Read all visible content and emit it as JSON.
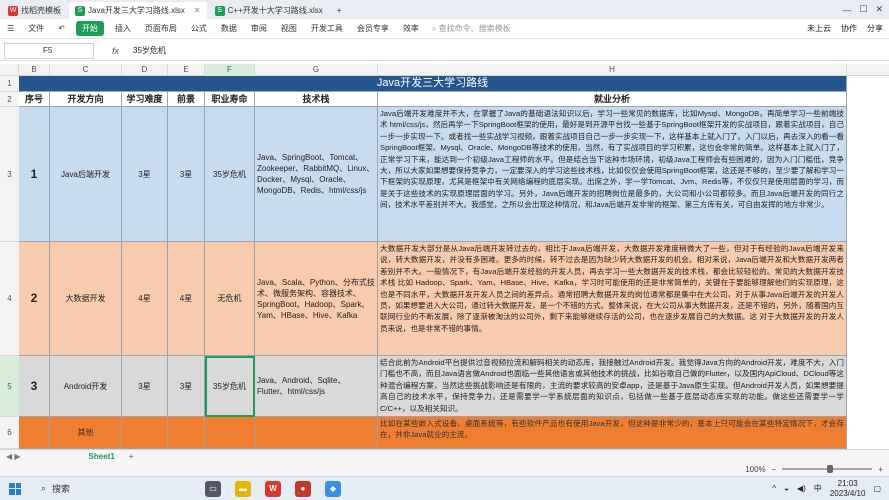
{
  "titlebar": {
    "tabs": [
      {
        "label": "找稻壳模板",
        "color": "#d9382b",
        "glyph": "W"
      },
      {
        "label": "Java开发三大学习路线.xlsx",
        "color": "#1f9c58",
        "glyph": "S",
        "active": true
      },
      {
        "label": "C++开发十大学习路线.xlsx",
        "color": "#1f9c58",
        "glyph": "S"
      }
    ],
    "add_tab": "+",
    "window_controls": [
      "—",
      "☐",
      "✕"
    ]
  },
  "ribbon": {
    "file": "文件",
    "menu_items": [
      "开始",
      "插入",
      "页面布局",
      "公式",
      "数据",
      "审阅",
      "视图",
      "开发工具",
      "会员专享",
      "效率"
    ],
    "search_placeholder": "查找命令、搜索模板",
    "right_items": [
      "未上云",
      "协作",
      "分享"
    ]
  },
  "formula_bar": {
    "cell_ref": "F5",
    "fx": "fx",
    "content": "35岁危机"
  },
  "columns": [
    "B",
    "C",
    "D",
    "E",
    "F",
    "G",
    "H"
  ],
  "selected_column": "F",
  "rows": [
    "1",
    "2",
    "3",
    "4",
    "5",
    "6"
  ],
  "selected_row": "5",
  "sheet": {
    "title": "Java开发三大学习路线",
    "headers": [
      "序号",
      "开发方向",
      "学习难度",
      "前景",
      "职业寿命",
      "技术栈",
      "就业分析"
    ],
    "data_rows": [
      {
        "num": "1",
        "direction": "Java后端开发",
        "difficulty": "3星",
        "prospect": "3星",
        "career": "35岁危机",
        "stack": "Java、SpringBoot、Tomcat、Zookeeper、RabbitMQ、Linux、Docker、Mysql、Oracle、MongoDB、Redis、html/css/js",
        "analysis": "Java后端开发难度并不大，在掌握了Java的基础语法知识以后，学习一些常见的数据库，比如Mysql、MongoDB，再简单学习一些前端技术 html/css/js，然后再学一下SpringBoot框架的使用，最好是到开源平台找一些基于SpringBoot框架开发的实战项目，跟着实战项目，自己一步一步实现一下。或者找一些实战学习视频，跟着实战项目自己一步一步实现一下，这样基本上就入门了。入门以后，再去深入的看一看SpringBoot框架、Mysql、Oracle、MongoDB等技术的使用，当然，有了实战项目的学习积累，这也会非常的简单。这样基本上就入门了，正常学习下来，能达到一个初级Java工程师的水平。但是结合当下这种市场环境，初级Java工程师会有些困难的，因为入门门槛低，竞争大，所以大家如果想要保持竞争力，一定要深入的学习这些技术栈，比如仅仅会使用SpringBoot框架，这还是不够的，至少要了解和学习一下框架的实现原理，尤其是框架中有关网络编程的底层实现。出席之外，学一学Tomcat、Jvm、Redis等，不仅仅只是使用层面的学习，而是关于这些技术的实现原理层面的学习。另外，Java后端开发的招聘岗位是最多的，大公司和小公司都较多。而且Java后端开发的同行之间，技术水平差别并不大。我感觉，之所以会出现这种情况，和Java后端开发非常的框架、第三方库有关，可自由发挥的地方非常少。"
      },
      {
        "num": "2",
        "direction": "大数据开发",
        "difficulty": "4星",
        "prospect": "4星",
        "career": "无危机",
        "stack": "Java、Scala、Python、分布式技术、微服务架构、容器技术、SpringBoot、Hadoop、Spark、Yam、HBase、Hive、Kafka",
        "analysis": "大数据开发大部分是从Java后端开发转过去的，相比于Java后端开发，大数据开发难度稍微大了一些，但对于有经验的Java后端开发来说，转大数据开发，并没有多困难。更多的时候，转不过去是因为缺少转大数据开发的机会。相对来说，Java后端开发和大数据开发两者差别并不大。一般情况下，有Java后端开发经验的开发人员，再去学习一些大数据开发的技术栈，都会比较轻松的。常见的大数据开发技术栈 比如 Hadoop、Spark、Yam、HBase、Hive、Kafka，学习时可能使用的还是非常简单的，关键在于要能够理解他们的实现原理，这也是不同水平，大数据开发开发人员之间的差异点。通常招聘大数据开发的岗位通常都是集中在大公司，对于从事Java后端开发的开发人员，如果想要进入大公司，通过转大数据开发，是一个不错的方式。整体来说，在大公司从事大数据开发，还是不错的，另外，随着国内互联网行业的不断发展，除了逐渐被淘汰的公司外，剩下来能够继续存活的公司，也在逐步发展自己的大数据。这 对于大数据开发的开发人员来说，也是非常不错的事情。"
      },
      {
        "num": "3",
        "direction": "Android开发",
        "difficulty": "3星",
        "prospect": "3星",
        "career": "35岁危机",
        "stack": "Java、Android、Sqlite、Flutter、html/css/js",
        "analysis": "结合此前为Android平台提供过音视频拉流和解码相关的动态库，我接触过Android开发。我觉得Java方向的Android开发，难度不大，入门门槛也不高，而且Java语言做Android也面临一些其他语言或其他技术的挑战，比如谷歌自己做的Flutter，以及国内ApiCloud、DCloud等这种混合编程方案，当然这些挑战影响还是有限的，主流的要求较高的安卓app，还是基于Java原生实现。但Android开发人员，如果想要提高自己的技术水平，保持竞争力，还是需要学一学系统层面的知识点，包括做一些基于底层动态库实现的功能。做这些还需要学一学C/C++，以及相关知识。"
      },
      {
        "num": "",
        "direction": "其他",
        "difficulty": "",
        "prospect": "",
        "career": "",
        "stack": "",
        "analysis": "比如在某些嵌入式设备、桌面系统等，有些软件产品也有使用Java开发，但这种是非常少的，基本上只可能会在某些特定情况下，才会存在，并非Java就业的主流。"
      }
    ]
  },
  "sheet_tabs": [
    "Sheet1"
  ],
  "status": {
    "zoom": "100%",
    "zoom_level": 0.5
  },
  "taskbar": {
    "search_label": "搜索",
    "time": "21:03",
    "date": "2023/4/10",
    "lang": "中"
  }
}
